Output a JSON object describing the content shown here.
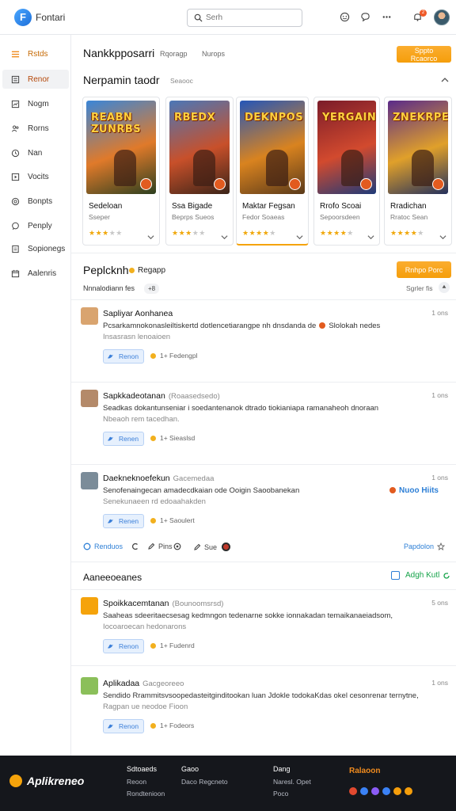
{
  "header": {
    "logo_text": "Fontari",
    "search_placeholder": "Serh",
    "notification_count": "2"
  },
  "sidebar": {
    "items": [
      {
        "label": "Rstds",
        "icon": "menu-icon"
      },
      {
        "label": "Renor",
        "icon": "list-icon"
      },
      {
        "label": "Nogm",
        "icon": "trending-icon"
      },
      {
        "label": "Rorns",
        "icon": "users-icon"
      },
      {
        "label": "Nan",
        "icon": "clock-icon"
      },
      {
        "label": "Vocits",
        "icon": "play-icon"
      },
      {
        "label": "Bonpts",
        "icon": "target-icon"
      },
      {
        "label": "Penply",
        "icon": "chat-icon"
      },
      {
        "label": "Sopionegs",
        "icon": "document-icon"
      },
      {
        "label": "Aalenris",
        "icon": "calendar-icon"
      }
    ]
  },
  "featured": {
    "title": "Nankkpposarri",
    "tabs": [
      "Rqoragp",
      "Nurops"
    ],
    "action_label": "Sppto Rcaorco"
  },
  "games_section": {
    "title": "Nerpamin taodr",
    "subtitle": "Seaooc",
    "cards": [
      {
        "art_title": "REABN ZUNRBS",
        "name": "Sedeloan",
        "genre": "Sseper",
        "rating": 3,
        "colors": [
          "#3a86d8",
          "#e07a2a",
          "#2c3f1f"
        ]
      },
      {
        "art_title": "RBEDX",
        "name": "Ssa Bigade",
        "genre": "Beprps Sueos",
        "rating": 3,
        "colors": [
          "#4b77b7",
          "#c8502a",
          "#3b2418"
        ]
      },
      {
        "art_title": "DEKNPOS",
        "name": "Maktar Fegsan",
        "genre": "Fedor Soaeas",
        "rating": 4,
        "colors": [
          "#2556b8",
          "#d9831f",
          "#5a3a1a"
        ]
      },
      {
        "art_title": "YERGAIN",
        "name": "Rrofo Scoai",
        "genre": "Sepoorsdeen",
        "rating": 4,
        "colors": [
          "#7b1c2a",
          "#d24a2e",
          "#1e3a78"
        ]
      },
      {
        "art_title": "ZNEKRPES",
        "name": "Rradichan",
        "genre": "Rratoc Sean",
        "rating": 4,
        "colors": [
          "#5a2a8a",
          "#e0a02a",
          "#24305c"
        ]
      }
    ]
  },
  "posts_section": {
    "title": "Peplcknh",
    "highlight": "Regapp",
    "action_label": "Rnhpo Porc",
    "filter_label": "Nnnalodiann fes",
    "filter_count": "+8",
    "sort_label": "Sgrler fis"
  },
  "posts": [
    {
      "name": "Sapliyar Aonhanea",
      "handle": "",
      "time": "1 ons",
      "line1": "Pcsarkamnokonasleiltiskertd dotlencetiarangpe nh dnsdanda de",
      "line1_tail": "Slolokah nedes",
      "line2": "Insasrasn lenoaioen",
      "like_label": "Renon",
      "react": "1+ Fedengpl"
    },
    {
      "name": "Sapkkadeotanan",
      "handle": "(Roaasedsedo)",
      "time": "1 ons",
      "line1": "Seadkas dokantunseniar i soedantenanok dtrado tiokianiapa ramanaheoh dnoraan",
      "line1_tail": "",
      "line2": "Nbeaoh rem tacedhan.",
      "like_label": "Renen",
      "react": "1+ Sieaslsd"
    },
    {
      "name": "Daekneknoefekun",
      "handle": "Gacemedaa",
      "time": "1 ons",
      "line1": "Senofenaingecan amadecdkaian ode Ooigin Saoobanekan",
      "line1_tail": "",
      "line2": "Senekunaeen rd edoaahakden",
      "like_label": "Renen",
      "react": "1+ Saoulert",
      "tag": "Nuoo Hiits"
    }
  ],
  "post_actions": {
    "left": "Renduos",
    "mid1": "Pins",
    "mid2": "Sue",
    "right": "Papdolon"
  },
  "announcements": {
    "title": "Aaneeoeanes",
    "action_label": "Adgh Kutl"
  },
  "announcement_posts": [
    {
      "name": "Spoikkacemtanan",
      "handle": "(Bounoomsrsd)",
      "time": "5 ons",
      "line1": "Saaheas sdeeritaecsesag kedmngon tedenarne sokke ionnakadan temaikanaeiadsom,",
      "line2": "Iocoaroecan hedonarons",
      "like_label": "Renon",
      "react": "1+ Fudenrd"
    },
    {
      "name": "Aplikadaa",
      "handle": "Gacgeoreeo",
      "time": "1 ons",
      "line1": "Sendido Rrammitsvsoopedasteitginditookan luan Jdokle todokaKdas okel cesonrenar ternytne,",
      "line2": "Ragpan ue neodoe Fioon",
      "like_label": "Renon",
      "react": "1+ Fodeors"
    }
  ],
  "footer": {
    "logo_text": "Aplikreneo",
    "cols": [
      {
        "head": "Sdtoaeds",
        "links": [
          "Reoon",
          "Rondtenioon"
        ]
      },
      {
        "head": "Gaoo",
        "links": [
          "Daco Regcneto"
        ]
      },
      {
        "head": "Dang",
        "links": [
          "Naresl. Opet",
          "Poco"
        ]
      }
    ],
    "highlight": "Ralaoon",
    "social_colors": [
      "#e2492f",
      "#3b82f6",
      "#8b5cf6",
      "#3b82f6",
      "#f59e0b",
      "#f59e0b"
    ]
  }
}
